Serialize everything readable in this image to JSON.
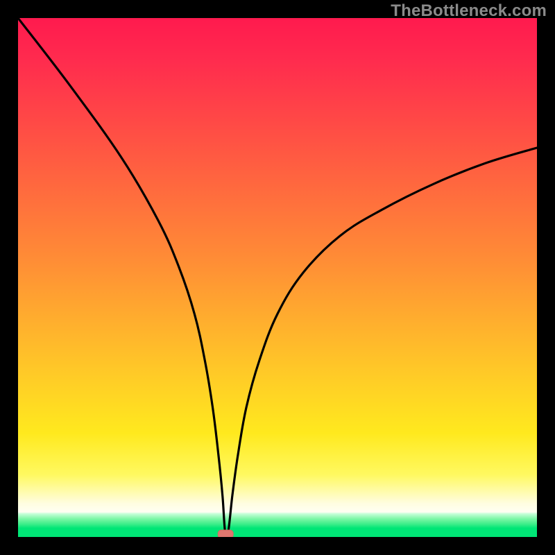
{
  "watermark": "TheBottleneck.com",
  "colors": {
    "gradient_top": "#ff1a4e",
    "gradient_mid": "#ffce26",
    "gradient_pale": "#fffde0",
    "gradient_green": "#00e676",
    "curve": "#000000",
    "marker": "#e0776f",
    "frame": "#000000"
  },
  "chart_data": {
    "type": "line",
    "title": "",
    "xlabel": "",
    "ylabel": "",
    "xlim": [
      0,
      100
    ],
    "ylim": [
      0,
      100
    ],
    "grid": false,
    "legend": false,
    "minimum": {
      "x": 40,
      "y": 0
    },
    "series": [
      {
        "name": "curve",
        "x": [
          0,
          10,
          20,
          27,
          31,
          34,
          36,
          37.5,
          38.6,
          39.4,
          39.9,
          40.5,
          41.3,
          42.4,
          44,
          46.5,
          50,
          55,
          62,
          70,
          80,
          90,
          100
        ],
        "y": [
          100,
          87,
          73,
          61,
          52,
          43,
          34,
          25,
          16,
          8,
          1,
          1,
          8,
          16,
          25,
          34,
          43,
          51,
          58,
          63,
          68,
          72,
          75
        ]
      }
    ],
    "annotation": {
      "type": "marker",
      "shape": "rounded-rect",
      "x": 40,
      "y": 0
    }
  }
}
